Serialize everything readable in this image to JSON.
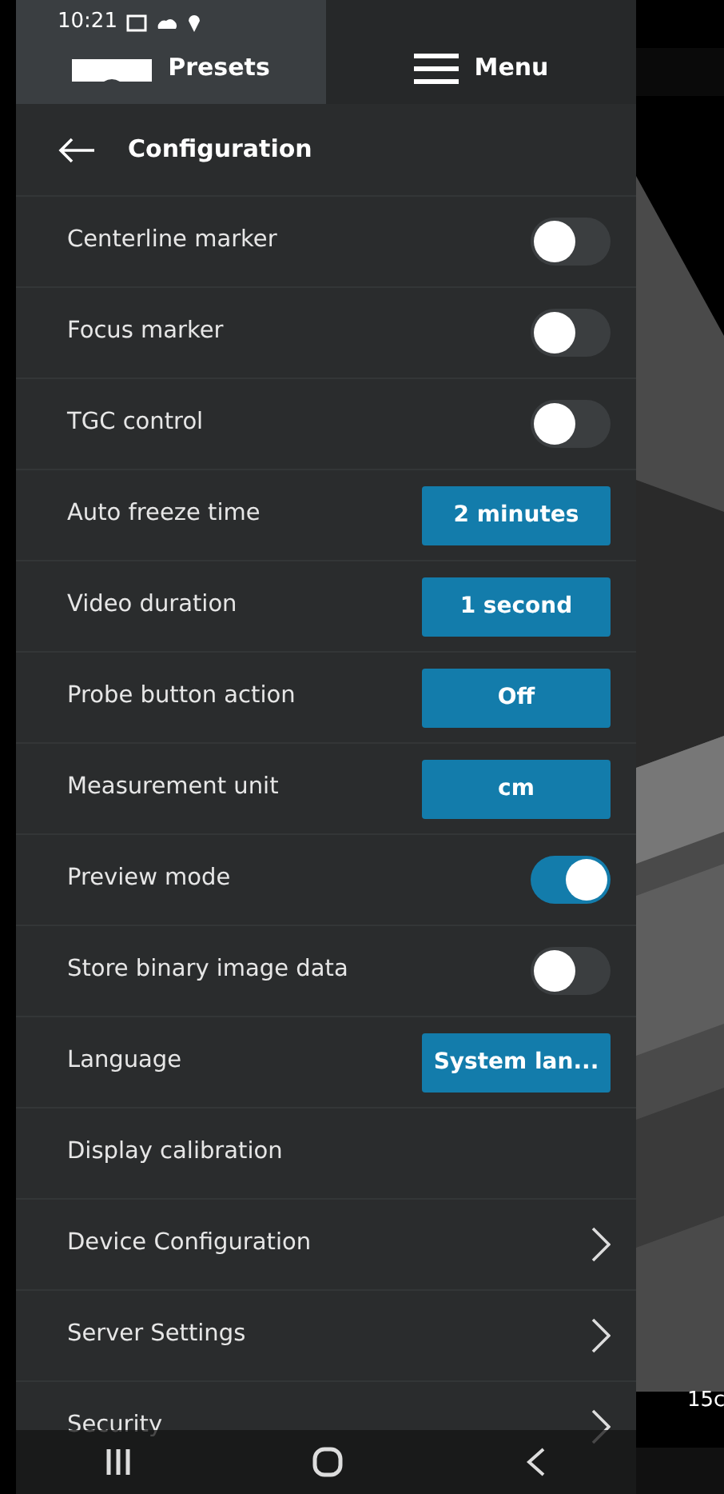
{
  "status_bar": {
    "time": "10:21"
  },
  "top_tabs": [
    {
      "label": "Presets",
      "selected": true
    },
    {
      "label": "Menu",
      "selected": false
    }
  ],
  "header": {
    "title": "Configuration"
  },
  "settings": [
    {
      "kind": "toggle",
      "label": "Centerline marker",
      "on": false
    },
    {
      "kind": "toggle",
      "label": "Focus marker",
      "on": false
    },
    {
      "kind": "toggle",
      "label": "TGC control",
      "on": false
    },
    {
      "kind": "button",
      "label": "Auto freeze time",
      "value": "2 minutes"
    },
    {
      "kind": "button",
      "label": "Video duration",
      "value": "1 second"
    },
    {
      "kind": "button",
      "label": "Probe button action",
      "value": "Off"
    },
    {
      "kind": "button",
      "label": "Measurement unit",
      "value": "cm"
    },
    {
      "kind": "toggle",
      "label": "Preview mode",
      "on": true
    },
    {
      "kind": "toggle",
      "label": "Store binary image data",
      "on": false
    },
    {
      "kind": "button",
      "label": "Language",
      "value": "System lan..."
    },
    {
      "kind": "plain",
      "label": "Display calibration"
    },
    {
      "kind": "link",
      "label": "Device Configuration"
    },
    {
      "kind": "link",
      "label": "Server Settings"
    },
    {
      "kind": "link",
      "label": "Security"
    }
  ],
  "image_overlay": {
    "depth_label": "15c"
  }
}
